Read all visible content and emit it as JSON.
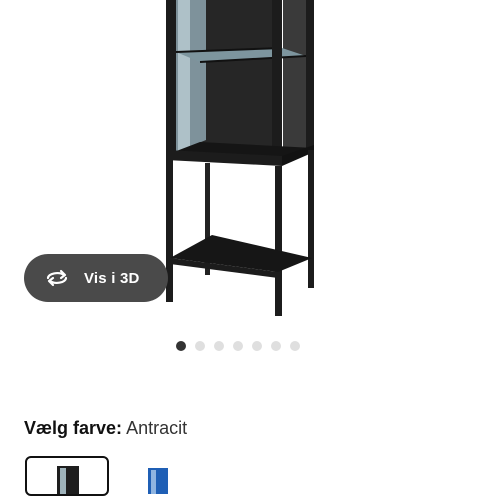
{
  "product": {
    "view3d_label": "Vis i 3D",
    "image_dots": {
      "count": 7,
      "active_index": 0
    }
  },
  "color": {
    "label": "Vælg farve:",
    "value": "Antracit",
    "swatches": [
      {
        "name": "antracit",
        "selected": true,
        "color": "#1e1e1e"
      },
      {
        "name": "blue",
        "selected": false,
        "color": "#1f5fb5"
      }
    ]
  },
  "colors": {
    "button_bg": "#4a4a4a",
    "cabinet": "#1c1c1c",
    "dot_active": "#333333",
    "dot_inactive": "#dfdfdf"
  }
}
